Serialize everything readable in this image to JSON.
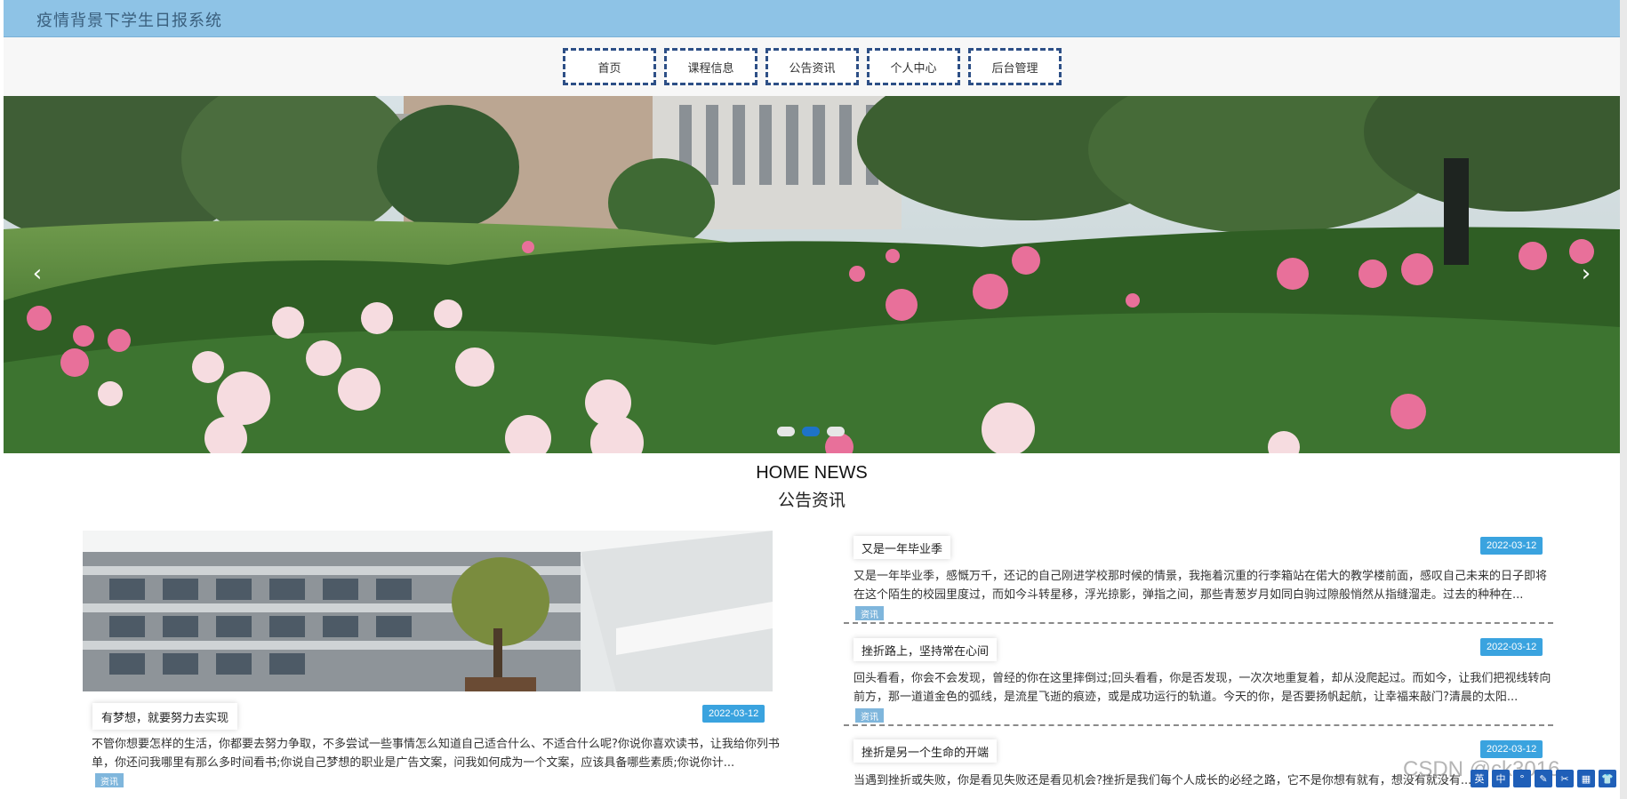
{
  "site": {
    "title": "疫情背景下学生日报系统"
  },
  "nav": [
    {
      "label": "首页"
    },
    {
      "label": "课程信息"
    },
    {
      "label": "公告资讯"
    },
    {
      "label": "个人中心"
    },
    {
      "label": "后台管理"
    }
  ],
  "banner": {
    "prev": "‹",
    "next": "›",
    "dots": 3,
    "active_dot": 2
  },
  "news": {
    "heading_en": "HOME NEWS",
    "heading_cn": "公告资讯",
    "featured": {
      "title": "有梦想，就要努力去实现",
      "date": "2022-03-12",
      "excerpt": "不管你想要怎样的生活，你都要去努力争取，不多尝试一些事情怎么知道自己适合什么、不适合什么呢?你说你喜欢读书，让我给你列书单，你还问我哪里有那么多时间看书;你说自己梦想的职业是广告文案，问我如何成为一个文案，应该具备哪些素质;你说你计...",
      "tag": "资讯"
    },
    "items": [
      {
        "title": "又是一年毕业季",
        "date": "2022-03-12",
        "excerpt": "又是一年毕业季，感慨万千，还记的自己刚进学校那时候的情景，我拖着沉重的行李箱站在偌大的教学楼前面，感叹自己未来的日子即将在这个陌生的校园里度过，而如今斗转星移，浮光掠影，弹指之间，那些青葱岁月如同白驹过隙般悄然从指缝溜走。过去的种种在...",
        "tag": "资讯"
      },
      {
        "title": "挫折路上，坚持常在心间",
        "date": "2022-03-12",
        "excerpt": "回头看看，你会不会发现，曾经的你在这里摔倒过;回头看看，你是否发现，一次次地重复着，却从没爬起过。而如今，让我们把视线转向前方，那一道道金色的弧线，是流星飞逝的痕迹，或是成功运行的轨道。今天的你，是否要扬帆起航，让幸福来敲门?清晨的太阳...",
        "tag": "资讯"
      },
      {
        "title": "挫折是另一个生命的开端",
        "date": "2022-03-12",
        "excerpt": "当遇到挫折或失败，你是看见失败还是看见机会?挫折是我们每个人成长的必经之路，它不是你想有就有，想没有就没有...",
        "tag": "资讯"
      }
    ]
  },
  "watermark": "CSDN @ck3016",
  "toolbar": [
    "英",
    "中",
    "°",
    "✎",
    "✂",
    "▦",
    "👕",
    "⚙"
  ],
  "colors": {
    "header_bg": "#8ec3e6",
    "nav_border": "#2d4f86",
    "date_badge": "#3aa3df",
    "tag_bg": "#7fb6dc"
  }
}
